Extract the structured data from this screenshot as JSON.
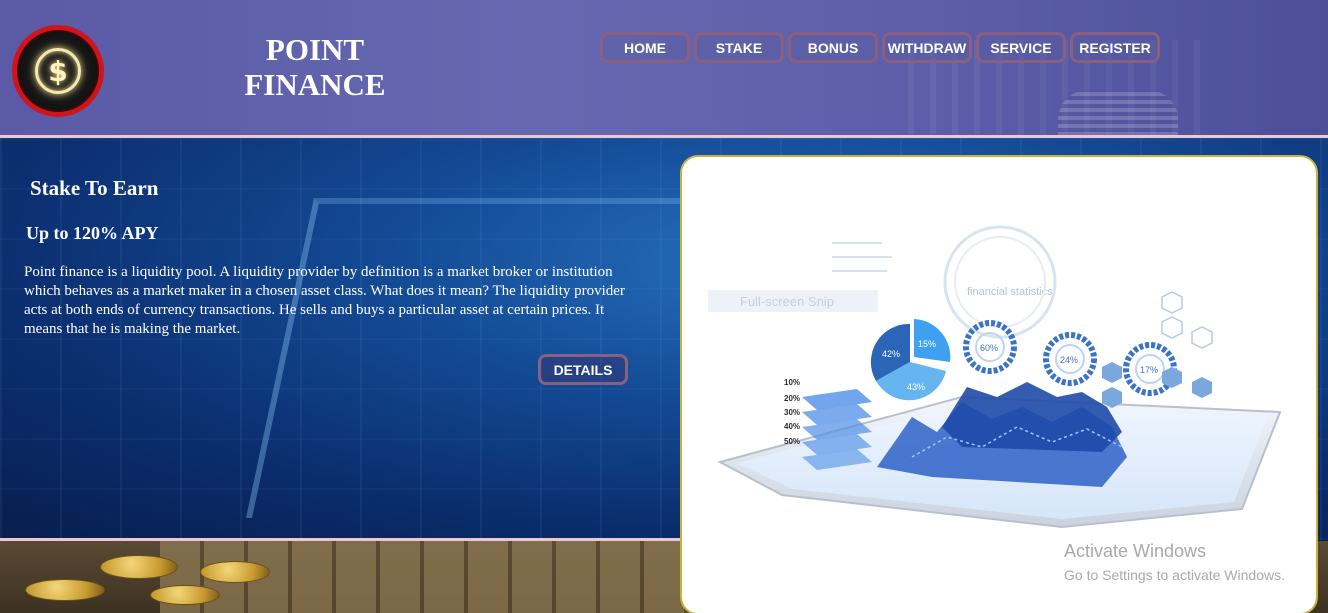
{
  "brand": {
    "logo_icon": "dollar-coin-icon",
    "name_line1": "POINT",
    "name_line2": "FINANCE"
  },
  "nav": {
    "items": [
      {
        "label": "HOME"
      },
      {
        "label": "STAKE"
      },
      {
        "label": "BONUS"
      },
      {
        "label": "WITHDRAW"
      },
      {
        "label": "SERVICE"
      },
      {
        "label": "REGISTER"
      }
    ]
  },
  "hero": {
    "title": "Stake To Earn",
    "subtitle": "Up to 120% APY",
    "description": "Point finance is a liquidity pool. A liquidity provider by definition is a market broker or institution which behaves as a market maker in a chosen asset class. What does it mean? The liquidity provider acts at both ends of currency transactions. He sells and buys a particular asset at certain prices. It means that he is making the market.",
    "details_label": "DETAILS"
  },
  "illustration": {
    "pie_labels": [
      "42%",
      "15%",
      "43%"
    ],
    "ring_labels": [
      "60%",
      "24%",
      "17%"
    ],
    "stack_labels": [
      "10%",
      "20%",
      "30%",
      "40%",
      "50%"
    ],
    "overlay_title": "financial statistics",
    "overlay_snip": "Full-screen Snip"
  },
  "watermark": {
    "title": "Activate Windows",
    "subtitle": "Go to Settings to activate Windows."
  },
  "colors": {
    "header_bg": "#6668b0",
    "nav_border": "#8b5f7d",
    "logo_ring": "#d0141c",
    "card_border": "#c9b13a",
    "hero_bg": "#14509a"
  }
}
